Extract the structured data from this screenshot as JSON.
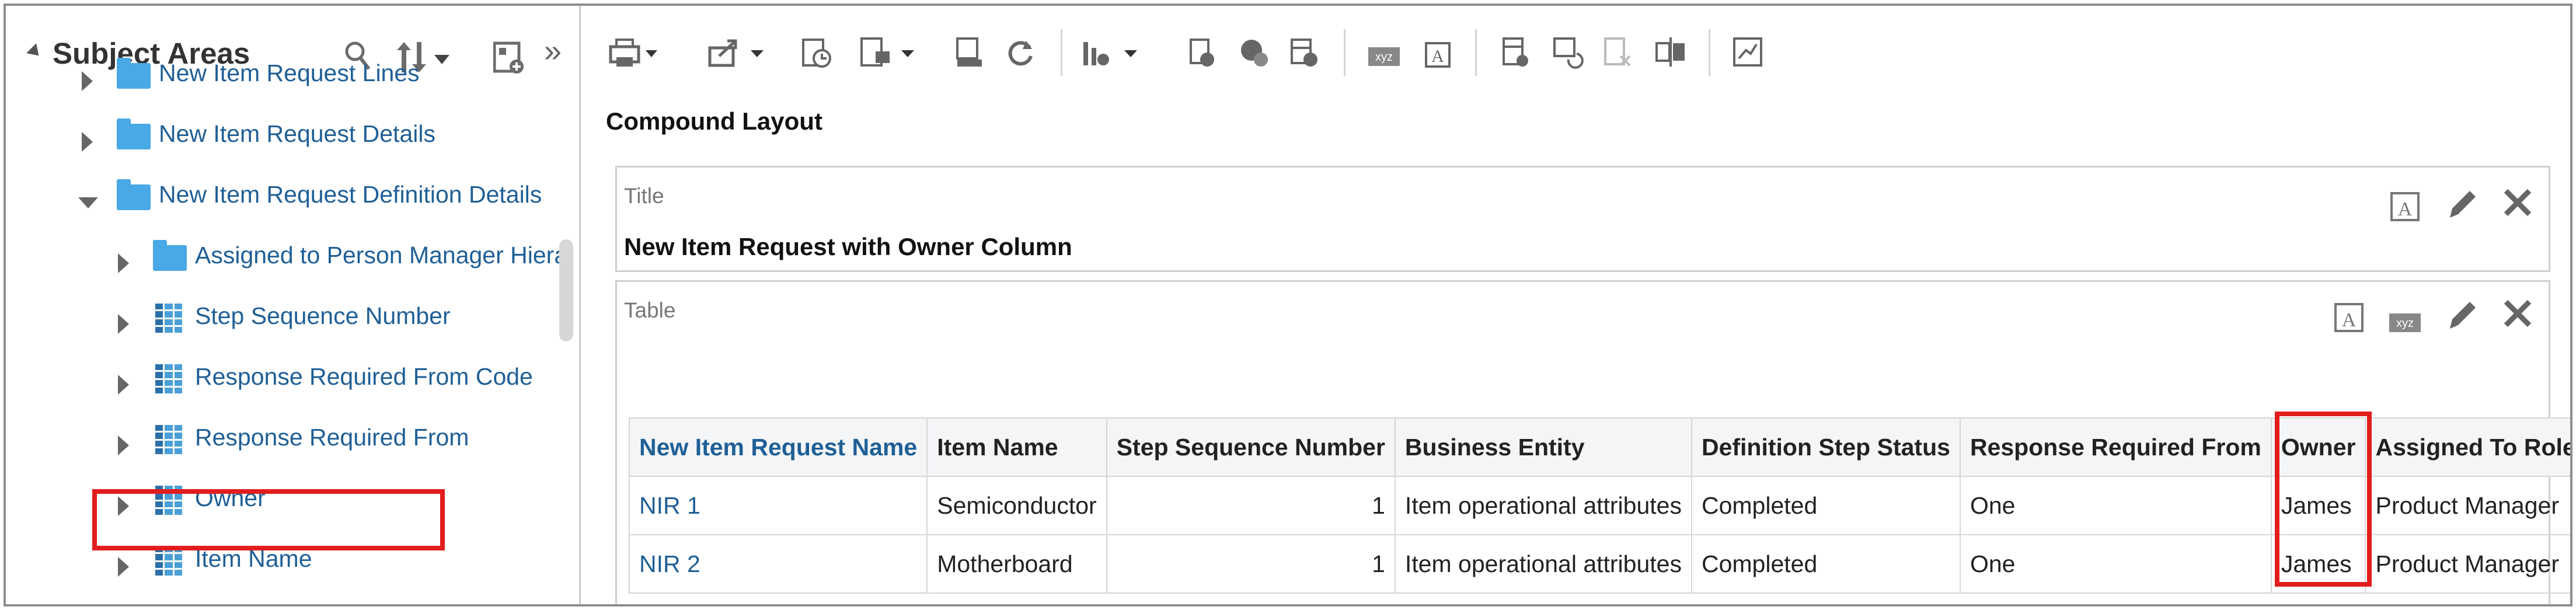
{
  "subject_areas": {
    "title": "Subject Areas",
    "header_icons": [
      "search-icon",
      "sort-icon",
      "add-column-icon",
      "collapse-panel-icon"
    ],
    "tree": [
      {
        "label": "New Item Request Lines",
        "kind": "folder",
        "level": 0,
        "state": "collapsed",
        "icon": "folder-icon"
      },
      {
        "label": "New Item Request Details",
        "kind": "folder",
        "level": 0,
        "state": "collapsed",
        "icon": "folder-icon"
      },
      {
        "label": "New Item Request Definition Details",
        "kind": "folder",
        "level": 0,
        "state": "expanded",
        "icon": "folder-icon"
      },
      {
        "label": "Assigned to Person Manager Hiera",
        "kind": "folder",
        "level": 1,
        "state": "collapsed",
        "icon": "folder-icon"
      },
      {
        "label": "Step Sequence Number",
        "kind": "column",
        "level": 1,
        "state": "collapsed",
        "icon": "column-icon"
      },
      {
        "label": "Response Required From Code",
        "kind": "column",
        "level": 1,
        "state": "collapsed",
        "icon": "column-icon"
      },
      {
        "label": "Response Required From",
        "kind": "column",
        "level": 1,
        "state": "collapsed",
        "icon": "column-icon"
      },
      {
        "label": "Owner",
        "kind": "column",
        "level": 1,
        "state": "collapsed",
        "icon": "column-icon",
        "highlighted": true
      },
      {
        "label": "Item Name",
        "kind": "column",
        "level": 1,
        "state": "collapsed",
        "icon": "column-icon"
      }
    ]
  },
  "toolbar": {
    "icons": [
      "print-icon",
      "export-icon",
      "refresh-schedule-icon",
      "save-layout-icon",
      "data-format-icon",
      "refresh-icon",
      "chart-icon",
      "add-filter-icon",
      "gauge-icon",
      "calculation-icon",
      "xyz-icon",
      "text-view-icon",
      "table-view-icon",
      "pivot-icon",
      "remove-icon",
      "split-icon",
      "graph-icon"
    ]
  },
  "compound_layout": {
    "label": "Compound Layout",
    "title_view": {
      "type_label": "Title",
      "title_text": "New Item Request with Owner Column"
    },
    "table_view": {
      "type_label": "Table",
      "columns": [
        "New Item Request Name",
        "Item Name",
        "Step Sequence Number",
        "Business Entity",
        "Definition Step Status",
        "Response Required From",
        "Owner",
        "Assigned To Role"
      ],
      "rows": [
        [
          "NIR 1",
          "Semiconductor",
          "1",
          "Item operational attributes",
          "Completed",
          "One",
          "James",
          "Product Manager"
        ],
        [
          "NIR 2",
          "Motherboard",
          "1",
          "Item operational attributes",
          "Completed",
          "One",
          "James",
          "Product Manager"
        ]
      ]
    }
  },
  "colors": {
    "link_blue": "#1f5f96",
    "folder_blue": "#49a8e6",
    "highlight_red": "#e21d1d"
  }
}
